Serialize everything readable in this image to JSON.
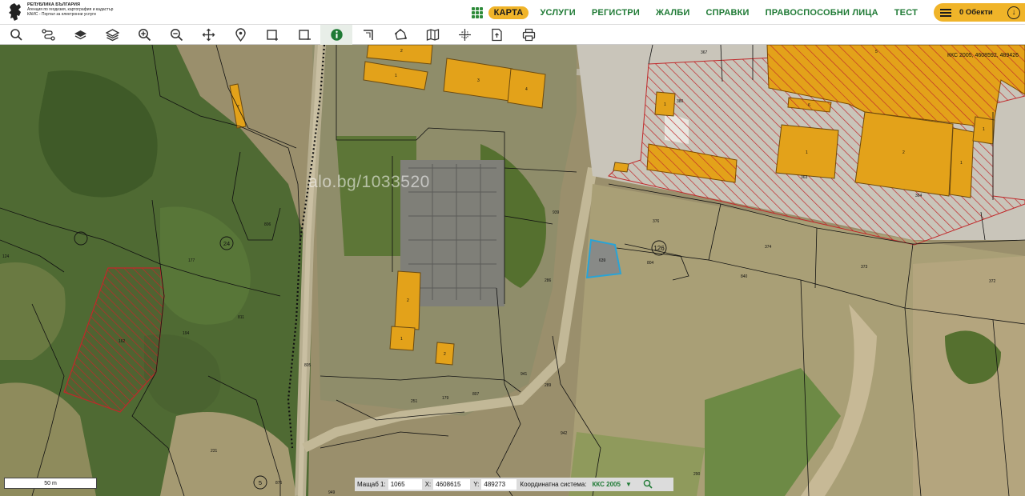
{
  "logo": {
    "line1": "РЕПУБЛИКА БЪЛГАРИЯ",
    "line2": "Агенция по геодезия, картография и кадастър",
    "line3": "КАИС - Портал за електронни услуги"
  },
  "nav": {
    "items": [
      "КАРТА",
      "УСЛУГИ",
      "РЕГИСТРИ",
      "ЖАЛБИ",
      "СПРАВКИ",
      "ПРАВОСПОСОБНИ ЛИЦА",
      "ТЕСТ"
    ],
    "active": "КАРТА",
    "objects_label": "0 Обекти"
  },
  "toolbar": {
    "tools": [
      "search-icon",
      "route-icon",
      "layers-icon",
      "layers-stack-icon",
      "zoom-in-icon",
      "zoom-out-icon",
      "pan-icon",
      "marker-icon",
      "select-rectangle-icon",
      "select-area-icon",
      "info-icon",
      "measure-angle-icon",
      "draw-polygon-icon",
      "map-icon",
      "crosshair-icon",
      "export-icon",
      "print-icon"
    ],
    "active_tool": "info-icon"
  },
  "map": {
    "crs_readout": "ККС 2005, 4608592, 489426",
    "watermark": "alo.bg/1033520",
    "scale_label": "50 m",
    "parcel_labels": [
      "126",
      "24",
      "5",
      "376",
      "374",
      "373",
      "372",
      "364",
      "363",
      "380",
      "367",
      "286",
      "289",
      "942",
      "941",
      "290",
      "231",
      "194",
      "162",
      "805",
      "806",
      "811",
      "177",
      "179",
      "251",
      "807",
      "639",
      "840",
      "804",
      "124",
      "876",
      "949",
      "939"
    ],
    "building_labels": [
      "1",
      "2",
      "3",
      "4",
      "5",
      "6",
      "7"
    ]
  },
  "status": {
    "scale_label": "Мащаб 1:",
    "scale_value": "1065",
    "x_label": "X:",
    "x_value": "4608615",
    "y_label": "Y:",
    "y_value": "489273",
    "crs_label": "Координатна система:",
    "crs_value": "ККС 2005"
  },
  "colors": {
    "brand_green": "#1f7a35",
    "accent_yellow": "#f0b429",
    "building_orange": "#e3a21a",
    "restricted_red": "#c0282a",
    "selected_blue": "#29a3d6"
  }
}
